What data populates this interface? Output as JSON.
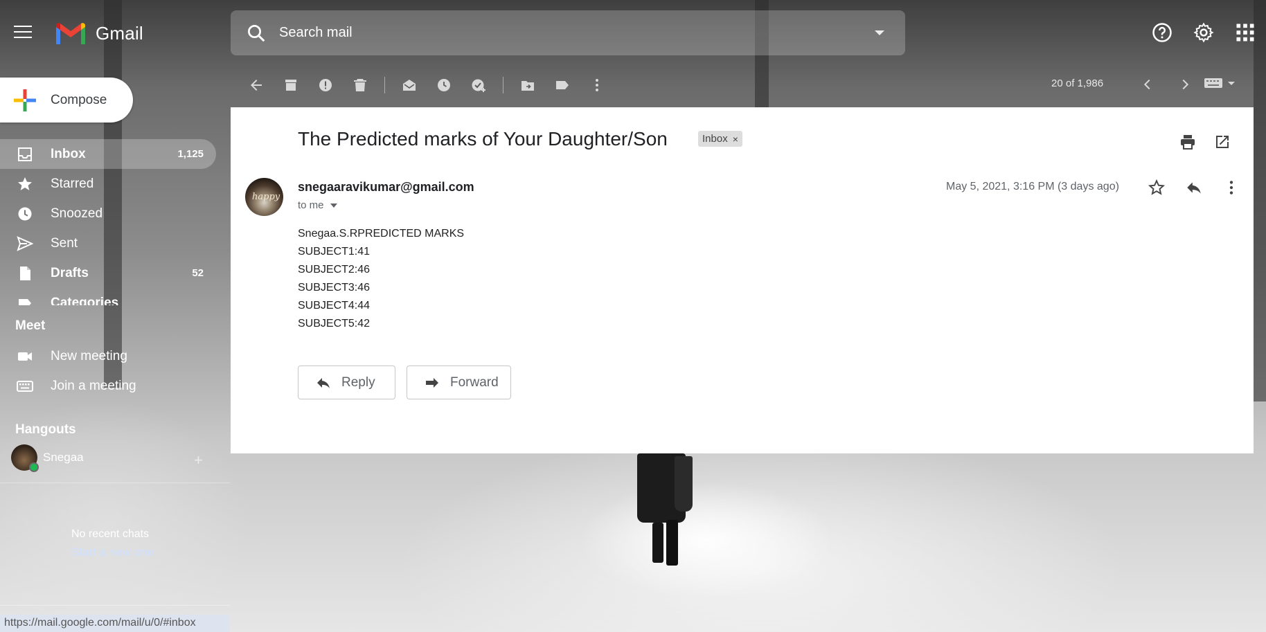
{
  "app": {
    "name": "Gmail"
  },
  "search": {
    "placeholder": "Search mail"
  },
  "compose": {
    "label": "Compose"
  },
  "sidebar": {
    "items": [
      {
        "label": "Inbox",
        "count": "1,125",
        "icon": "inbox-icon",
        "active": true,
        "bold": true
      },
      {
        "label": "Starred",
        "count": "",
        "icon": "star-icon"
      },
      {
        "label": "Snoozed",
        "count": "",
        "icon": "clock-icon"
      },
      {
        "label": "Sent",
        "count": "",
        "icon": "send-icon"
      },
      {
        "label": "Drafts",
        "count": "52",
        "icon": "draft-icon",
        "bold": true
      },
      {
        "label": "Categories",
        "count": "",
        "icon": "label-icon",
        "bold": true
      }
    ]
  },
  "meet": {
    "title": "Meet",
    "items": [
      {
        "label": "New meeting",
        "icon": "video-icon"
      },
      {
        "label": "Join a meeting",
        "icon": "keyboard-icon"
      }
    ]
  },
  "hangouts": {
    "title": "Hangouts",
    "user": "Snegaa",
    "add": "+",
    "no_chats": "No recent chats",
    "start_new": "Start a new one"
  },
  "status_url": "https://mail.google.com/mail/u/0/#inbox",
  "toolbar": {
    "paging": "20 of 1,986"
  },
  "message": {
    "subject": "The Predicted marks of Your Daughter/Son",
    "label": "Inbox",
    "label_remove": "×",
    "sender": "snegaaravikumar@gmail.com",
    "avatar_text": "happy",
    "to": "to me",
    "date": "May 5, 2021, 3:16 PM (3 days ago)",
    "body": [
      "Snegaa.S.RPREDICTED MARKS",
      "SUBJECT1:41",
      "SUBJECT2:46",
      "SUBJECT3:46",
      "SUBJECT4:44",
      "SUBJECT5:42"
    ],
    "reply_label": "Reply",
    "forward_label": "Forward"
  }
}
